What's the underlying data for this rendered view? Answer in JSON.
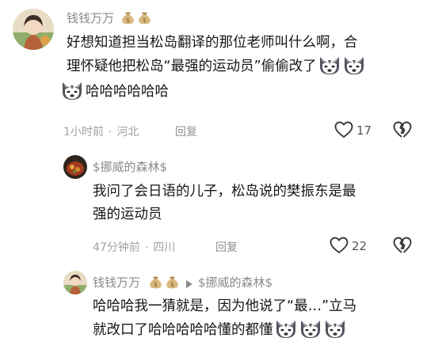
{
  "comments": [
    {
      "user": "钱钱万万",
      "text_a": "好想知道担当松岛翻译的那位老师叫什么啊，合",
      "text_b": "理怀疑他把松岛“最强的运动员”偷偷改了",
      "text_c": "哈哈哈哈哈哈",
      "time": "1小时前",
      "location": "河北",
      "reply_label": "回复",
      "likes": "17",
      "emoji_name": "husky-dog-emoji"
    },
    {
      "user": "$挪威的森林$",
      "text_a": "我问了会日语的儿子，松岛说的樊振东是最",
      "text_b": "强的运动员",
      "time": "47分钟前",
      "location": "四川",
      "reply_label": "回复",
      "likes": "22"
    },
    {
      "user": "钱钱万万",
      "reply_to": "$挪威的森林$",
      "text_a": "哈哈哈我一猜就是，因为他说了“最…”立马",
      "text_b": "就改口了哈哈哈哈哈懂的都懂",
      "emoji_name": "husky-dog-emoji"
    }
  ],
  "colors": {
    "name": "#8a8a8a",
    "meta": "#a2a2a2",
    "text": "#161616"
  }
}
